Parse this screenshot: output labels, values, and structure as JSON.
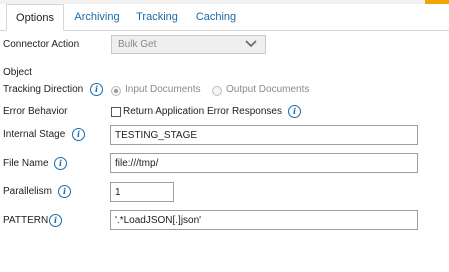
{
  "tabs": [
    {
      "label": "Options",
      "active": true
    },
    {
      "label": "Archiving",
      "active": false
    },
    {
      "label": "Tracking",
      "active": false
    },
    {
      "label": "Caching",
      "active": false
    }
  ],
  "connector_action": {
    "label": "Connector Action",
    "value": "Bulk Get"
  },
  "object": {
    "label": "Object"
  },
  "tracking_direction": {
    "label": "Tracking Direction",
    "options": [
      {
        "label": "Input Documents",
        "selected": true
      },
      {
        "label": "Output Documents",
        "selected": false
      }
    ]
  },
  "error_behavior": {
    "label": "Error Behavior",
    "checkbox_label": "Return Application Error Responses",
    "checked": false
  },
  "internal_stage": {
    "label": "Internal Stage",
    "value": "TESTING_STAGE"
  },
  "file_name": {
    "label": "File Name",
    "value": "file:///tmp/"
  },
  "parallelism": {
    "label": "Parallelism",
    "value": "1"
  },
  "pattern": {
    "label": "PATTERN",
    "value": "'.*LoadJSON[.]json'"
  },
  "info_glyph": "i",
  "colors": {
    "link": "#1a6aa8",
    "top_accent": "#f0a500",
    "disabled_text": "#888888"
  }
}
